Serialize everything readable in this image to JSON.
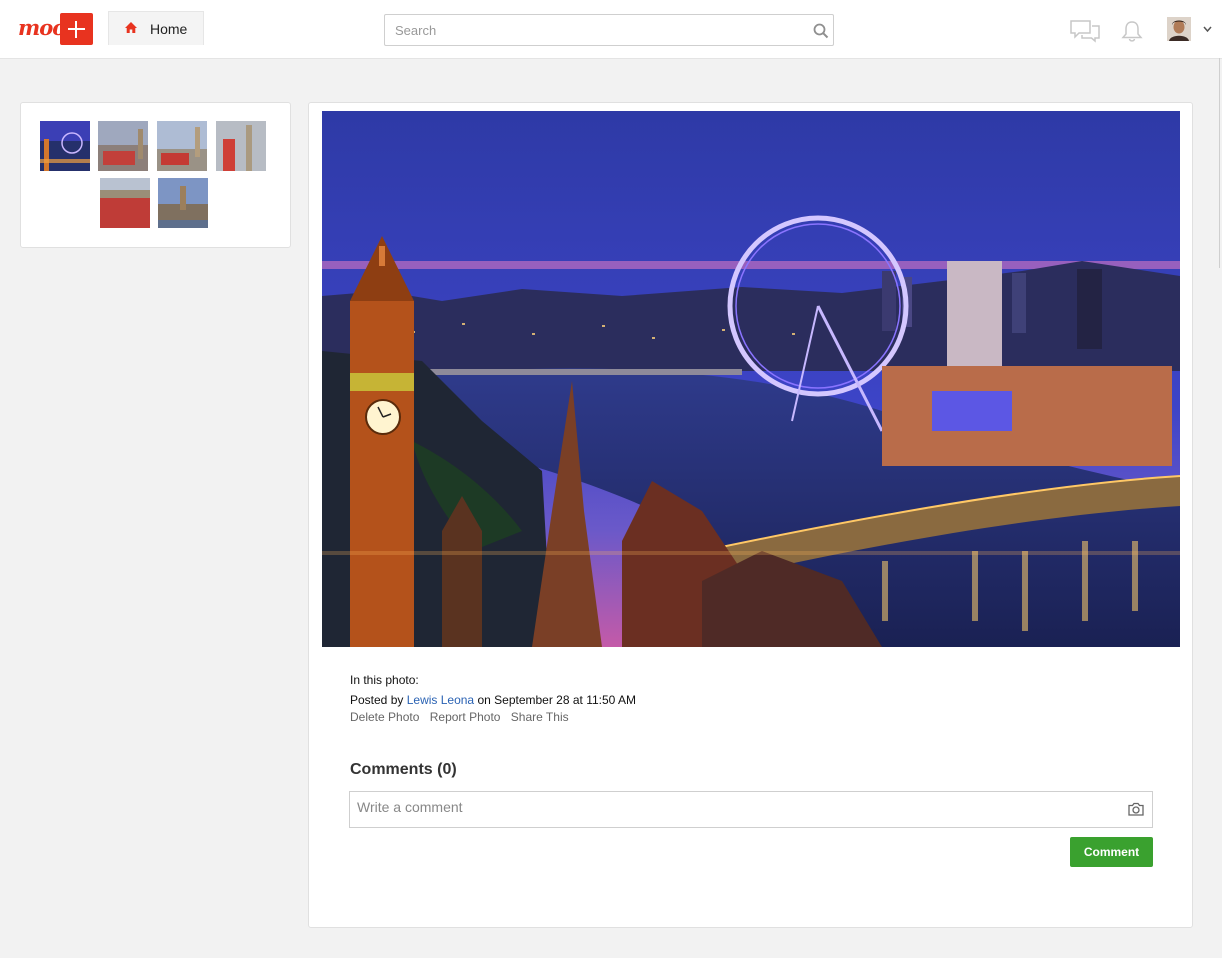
{
  "header": {
    "logo_text": "moo",
    "home_tab_label": "Home",
    "search_placeholder": "Search",
    "icons": [
      "plus-icon",
      "home-icon",
      "search-icon",
      "messages-icon",
      "bell-icon",
      "chevron-down-icon"
    ],
    "brand_color": "#e8331f"
  },
  "album": {
    "thumbnails": [
      {
        "name": "thumb-london-eye-night"
      },
      {
        "name": "thumb-bus-big-ben"
      },
      {
        "name": "thumb-bus-westminster"
      },
      {
        "name": "thumb-phone-box"
      },
      {
        "name": "thumb-red-bus-closeup"
      },
      {
        "name": "thumb-parliament"
      }
    ]
  },
  "photo": {
    "in_this_photo_label": "In this photo:",
    "posted_by_prefix": "Posted by",
    "author": "Lewis Leona",
    "posted_suffix": "on September 28 at 11:50 AM",
    "actions": {
      "delete": "Delete Photo",
      "report": "Report Photo",
      "share": "Share This"
    }
  },
  "comments": {
    "heading": "Comments",
    "count_label": "(0)",
    "placeholder": "Write a comment",
    "submit_label": "Comment",
    "submit_color": "#3aa12f"
  }
}
